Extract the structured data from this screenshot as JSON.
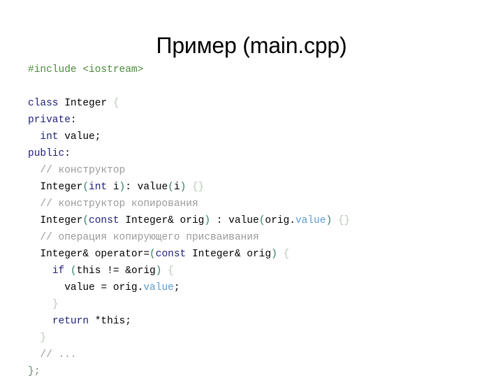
{
  "slide": {
    "title": "Пример (main.cpp)",
    "background_color": "#ffffff",
    "colors": {
      "title": "#000000",
      "plain": "#000000",
      "keyword": "#20207a",
      "preprocessor": "#4a8a3a",
      "comment": "#9a9a9a",
      "paren": "#2f7f5f",
      "brace": "#b9c9b9",
      "member": "#5a9ad0",
      "end_brace": "#6a8a6a"
    }
  },
  "code": {
    "language": "cpp",
    "lines": [
      {
        "indent": 0,
        "tokens": [
          {
            "text": "#include <iostream>",
            "kind": "pre"
          }
        ]
      },
      {
        "indent": 0,
        "blank": true,
        "tokens": []
      },
      {
        "indent": 0,
        "tokens": [
          {
            "text": "class",
            "kind": "keyword"
          },
          {
            "text": " Integer ",
            "kind": "plain"
          },
          {
            "text": "{",
            "kind": "brace"
          }
        ]
      },
      {
        "indent": 0,
        "tokens": [
          {
            "text": "private",
            "kind": "keyword"
          },
          {
            "text": ":",
            "kind": "plain"
          }
        ]
      },
      {
        "indent": 1,
        "tokens": [
          {
            "text": "int",
            "kind": "keyword"
          },
          {
            "text": " value;",
            "kind": "plain"
          }
        ]
      },
      {
        "indent": 0,
        "tokens": [
          {
            "text": "public",
            "kind": "keyword"
          },
          {
            "text": ":",
            "kind": "plain"
          }
        ]
      },
      {
        "indent": 1,
        "tokens": [
          {
            "text": "// конструктор",
            "kind": "comment"
          }
        ]
      },
      {
        "indent": 1,
        "tokens": [
          {
            "text": "Integer",
            "kind": "plain"
          },
          {
            "text": "(",
            "kind": "paren"
          },
          {
            "text": "int",
            "kind": "keyword"
          },
          {
            "text": " i",
            "kind": "plain"
          },
          {
            "text": ")",
            "kind": "paren"
          },
          {
            "text": ": value",
            "kind": "plain"
          },
          {
            "text": "(",
            "kind": "paren"
          },
          {
            "text": "i",
            "kind": "plain"
          },
          {
            "text": ")",
            "kind": "paren"
          },
          {
            "text": " ",
            "kind": "plain"
          },
          {
            "text": "{}",
            "kind": "brace"
          }
        ]
      },
      {
        "indent": 1,
        "tokens": [
          {
            "text": "// конструктор копирования",
            "kind": "comment"
          }
        ]
      },
      {
        "indent": 1,
        "tokens": [
          {
            "text": "Integer",
            "kind": "plain"
          },
          {
            "text": "(",
            "kind": "paren"
          },
          {
            "text": "const",
            "kind": "keyword"
          },
          {
            "text": " Integer& orig",
            "kind": "plain"
          },
          {
            "text": ")",
            "kind": "paren"
          },
          {
            "text": " : value",
            "kind": "plain"
          },
          {
            "text": "(",
            "kind": "paren"
          },
          {
            "text": "orig.",
            "kind": "plain"
          },
          {
            "text": "value",
            "kind": "member"
          },
          {
            "text": ")",
            "kind": "paren"
          },
          {
            "text": " ",
            "kind": "plain"
          },
          {
            "text": "{}",
            "kind": "brace"
          }
        ]
      },
      {
        "indent": 1,
        "tokens": [
          {
            "text": "// операция копирующего присваивания",
            "kind": "comment"
          }
        ]
      },
      {
        "indent": 1,
        "tokens": [
          {
            "text": "Integer& operator=",
            "kind": "plain"
          },
          {
            "text": "(",
            "kind": "paren"
          },
          {
            "text": "const",
            "kind": "keyword"
          },
          {
            "text": " Integer& orig",
            "kind": "plain"
          },
          {
            "text": ")",
            "kind": "paren"
          },
          {
            "text": " ",
            "kind": "plain"
          },
          {
            "text": "{",
            "kind": "brace"
          }
        ]
      },
      {
        "indent": 2,
        "tokens": [
          {
            "text": "if",
            "kind": "keyword"
          },
          {
            "text": " ",
            "kind": "plain"
          },
          {
            "text": "(",
            "kind": "paren"
          },
          {
            "text": "this != &orig",
            "kind": "plain"
          },
          {
            "text": ")",
            "kind": "paren"
          },
          {
            "text": " ",
            "kind": "plain"
          },
          {
            "text": "{",
            "kind": "brace"
          }
        ]
      },
      {
        "indent": 3,
        "tokens": [
          {
            "text": "value = orig.",
            "kind": "plain"
          },
          {
            "text": "value",
            "kind": "member"
          },
          {
            "text": ";",
            "kind": "plain"
          }
        ]
      },
      {
        "indent": 2,
        "tokens": [
          {
            "text": "}",
            "kind": "brace"
          }
        ]
      },
      {
        "indent": 2,
        "tokens": [
          {
            "text": "return",
            "kind": "keyword"
          },
          {
            "text": " *this;",
            "kind": "plain"
          }
        ]
      },
      {
        "indent": 1,
        "tokens": [
          {
            "text": "}",
            "kind": "brace"
          }
        ]
      },
      {
        "indent": 1,
        "tokens": [
          {
            "text": "// ...",
            "kind": "comment"
          }
        ]
      },
      {
        "indent": 0,
        "tokens": [
          {
            "text": "};",
            "kind": "end_brace"
          }
        ]
      }
    ]
  }
}
